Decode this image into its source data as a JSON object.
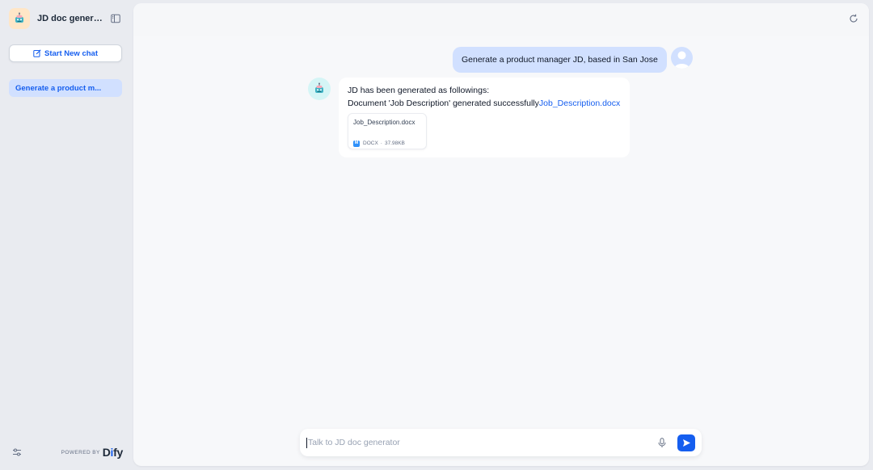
{
  "app": {
    "title": "JD doc generat...",
    "icon": "robot-bot-icon"
  },
  "sidebar": {
    "new_chat_label": "Start New chat",
    "conversations": [
      {
        "label": "Generate a product m..."
      }
    ],
    "footer": {
      "powered_by": "POWERED BY",
      "brand_prefix": "D",
      "brand_mid": "i",
      "brand_suffix": "fy"
    }
  },
  "chat": {
    "messages": {
      "user": "Generate a product manager JD, based in San Jose",
      "bot_line1": "JD has been generated as followings:",
      "bot_line2_prefix": "Document 'Job Description' generated successfully",
      "bot_link": "Job_Description.docx",
      "file": {
        "name": "Job_Description.docx",
        "type": "DOCX",
        "separator": "·",
        "size": "37.98KB",
        "badge": "M"
      }
    },
    "input": {
      "placeholder": "Talk to JD doc generator",
      "value": ""
    }
  },
  "colors": {
    "accent": "#155eef",
    "user_bubble": "#d1e0ff",
    "sidebar_bg": "#e9ebf0",
    "main_bg": "#f7f8fa"
  }
}
